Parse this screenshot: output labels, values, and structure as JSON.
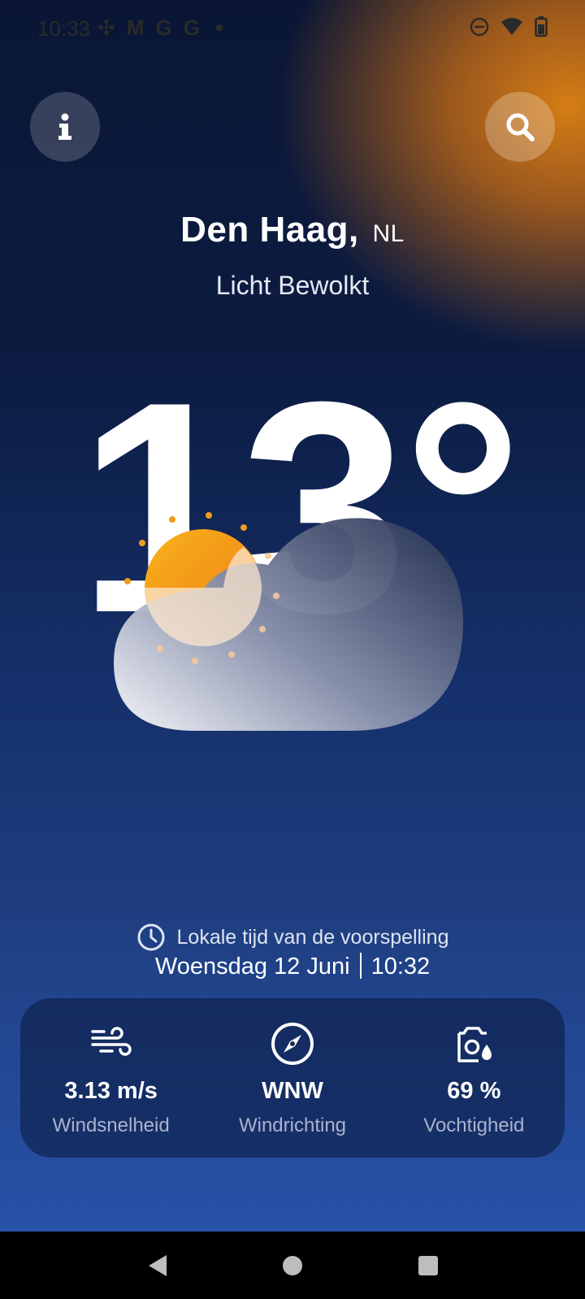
{
  "status_bar": {
    "time": "10:33",
    "left_icons": [
      "slack-icon",
      "gmail-icon",
      "google-icon",
      "google-icon",
      "dot-icon"
    ],
    "right_icons": [
      "do-not-disturb-icon",
      "wifi-icon",
      "battery-icon"
    ]
  },
  "header": {
    "info_icon": "info-icon",
    "search_icon": "search-icon"
  },
  "location": {
    "city": "Den Haag,",
    "country": "NL"
  },
  "condition": "Licht Bewolkt",
  "temperature": "13°",
  "forecast_time": {
    "label": "Lokale tijd van de voorspelling",
    "date": "Woensdag 12 Juni",
    "time": "10:32"
  },
  "stats": [
    {
      "icon": "wind-icon",
      "value": "3.13 m/s",
      "label": "Windsnelheid"
    },
    {
      "icon": "compass-icon",
      "value": "WNW",
      "label": "Windrichting"
    },
    {
      "icon": "humidity-icon",
      "value": "69 %",
      "label": "Vochtigheid"
    }
  ],
  "colors": {
    "accent_orange": "#e08212",
    "sun_orange": "#f39a1e",
    "background_top": "#0a1634",
    "background_bottom": "#2752a8"
  }
}
